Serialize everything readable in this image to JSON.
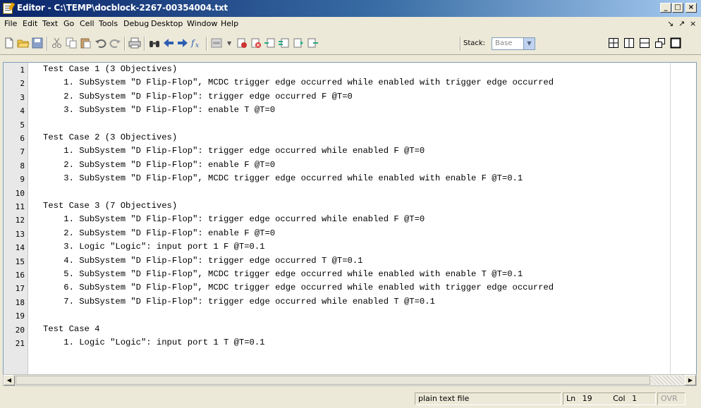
{
  "window": {
    "title": "Editor - C:\\TEMP\\docblock-2267-00354004.txt",
    "minimize": "_",
    "maximize": "□",
    "close": "×"
  },
  "menu": {
    "items": [
      "File",
      "Edit",
      "Text",
      "Go",
      "Cell",
      "Tools",
      "Debug",
      "Desktop",
      "Window",
      "Help"
    ],
    "dock_icons": [
      "↘",
      "↗",
      "×"
    ]
  },
  "toolbar": {
    "icons": [
      "new-file-icon",
      "open-folder-icon",
      "save-icon",
      "cut-icon",
      "copy-icon",
      "paste-icon",
      "undo-icon",
      "redo-icon",
      "print-icon",
      "find-icon",
      "back-icon",
      "forward-icon",
      "function-icon",
      "cell-icon",
      "breakpoint-icon",
      "clear-breakpoints-icon",
      "step-icon",
      "step-in-icon",
      "step-out-icon",
      "continue-icon"
    ],
    "stack_label": "Stack:",
    "stack_value": "Base",
    "layout_icons": [
      "tile-icon",
      "split-vertical-icon",
      "split-horizontal-icon",
      "float-icon",
      "maximize-pane-icon"
    ]
  },
  "editor": {
    "lines": [
      "Test Case 1 (3 Objectives)",
      "    1. SubSystem \"D Flip-Flop\", MCDC trigger edge occurred while enabled with trigger edge occurred",
      "    2. SubSystem \"D Flip-Flop\": trigger edge occurred F @T=0",
      "    3. SubSystem \"D Flip-Flop\": enable T @T=0",
      "",
      "Test Case 2 (3 Objectives)",
      "    1. SubSystem \"D Flip-Flop\": trigger edge occurred while enabled F @T=0",
      "    2. SubSystem \"D Flip-Flop\": enable F @T=0",
      "    3. SubSystem \"D Flip-Flop\", MCDC trigger edge occurred while enabled with enable F @T=0.1",
      "",
      "Test Case 3 (7 Objectives)",
      "    1. SubSystem \"D Flip-Flop\": trigger edge occurred while enabled F @T=0",
      "    2. SubSystem \"D Flip-Flop\": enable F @T=0",
      "    3. Logic \"Logic\": input port 1 F @T=0.1",
      "    4. SubSystem \"D Flip-Flop\": trigger edge occurred T @T=0.1",
      "    5. SubSystem \"D Flip-Flop\", MCDC trigger edge occurred while enabled with enable T @T=0.1",
      "    6. SubSystem \"D Flip-Flop\", MCDC trigger edge occurred while enabled with trigger edge occurred",
      "    7. SubSystem \"D Flip-Flop\": trigger edge occurred while enabled T @T=0.1",
      "",
      "Test Case 4",
      "    1. Logic \"Logic\": input port 1 T @T=0.1"
    ]
  },
  "status": {
    "file_type": "plain text file",
    "ln_label": "Ln",
    "ln_value": "19",
    "col_label": "Col",
    "col_value": "1",
    "mode": "OVR"
  }
}
